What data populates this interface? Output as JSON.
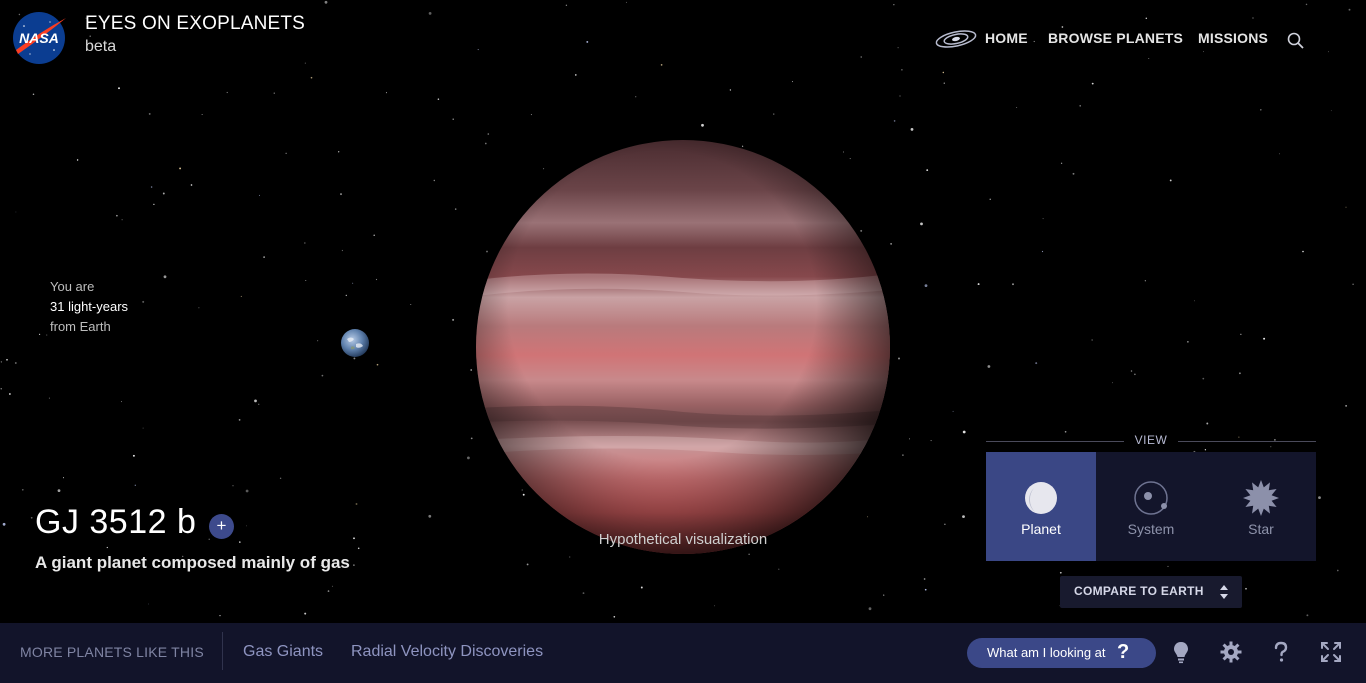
{
  "header": {
    "logo_text": "NASA",
    "app_title": "EYES ON EXOPLANETS",
    "app_subtitle": "beta"
  },
  "nav": {
    "items": [
      "HOME",
      "BROWSE PLANETS",
      "MISSIONS"
    ],
    "icons": [
      "galaxy-icon",
      "search-icon"
    ]
  },
  "location": {
    "line1": "You are",
    "distance": "31 light-years",
    "line3": "from Earth"
  },
  "planet": {
    "name": "GJ 3512 b",
    "add_label": "+",
    "description": "A giant planet composed mainly of gas",
    "visualization_note": "Hypothetical visualization"
  },
  "view": {
    "label": "VIEW",
    "options": [
      {
        "label": "Planet",
        "icon": "planet-icon",
        "active": true
      },
      {
        "label": "System",
        "icon": "system-icon",
        "active": false
      },
      {
        "label": "Star",
        "icon": "star-icon",
        "active": false
      }
    ]
  },
  "compare": {
    "label": "COMPARE TO EARTH"
  },
  "bottom_bar": {
    "more_label": "MORE PLANETS LIKE THIS",
    "tags": [
      "Gas Giants",
      "Radial Velocity Discoveries"
    ],
    "looking_label": "What am I looking at",
    "looking_q": "?",
    "icons": [
      "lightbulb-icon",
      "gear-icon",
      "help-icon",
      "fullscreen-icon"
    ]
  },
  "colors": {
    "background": "#000000",
    "bar": "#12142a",
    "accent": "#3b4888",
    "panel": "#13152b",
    "tag_text": "#8e94c0"
  }
}
